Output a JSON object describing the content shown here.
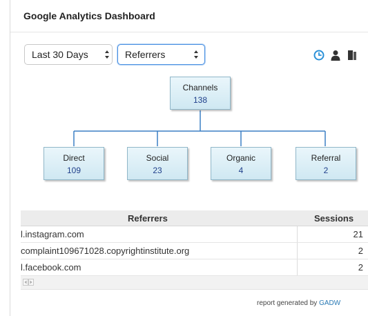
{
  "widget": {
    "title": "Google Analytics Dashboard"
  },
  "controls": {
    "date_range": {
      "selected": "Last 30 Days"
    },
    "report": {
      "selected": "Referrers"
    },
    "icons": [
      "clock-icon",
      "user-icon",
      "copy-icon"
    ]
  },
  "tree": {
    "root": {
      "label": "Channels",
      "value": "138"
    },
    "children": [
      {
        "label": "Direct",
        "value": "109"
      },
      {
        "label": "Social",
        "value": "23"
      },
      {
        "label": "Organic",
        "value": "4"
      },
      {
        "label": "Referral",
        "value": "2"
      }
    ]
  },
  "table": {
    "headers": {
      "referrers": "Referrers",
      "sessions": "Sessions"
    },
    "rows": [
      {
        "referrer": "l.instagram.com",
        "sessions": "21"
      },
      {
        "referrer": "complaint109671028.copyrightinstitute.org",
        "sessions": "2"
      },
      {
        "referrer": "l.facebook.com",
        "sessions": "2"
      }
    ]
  },
  "footer": {
    "credit_prefix": "report generated by",
    "credit_brand": "GADW"
  },
  "colors": {
    "accent": "#2a90d8",
    "node_value": "#1f3f8a",
    "tree_line": "#3a7fc4"
  }
}
